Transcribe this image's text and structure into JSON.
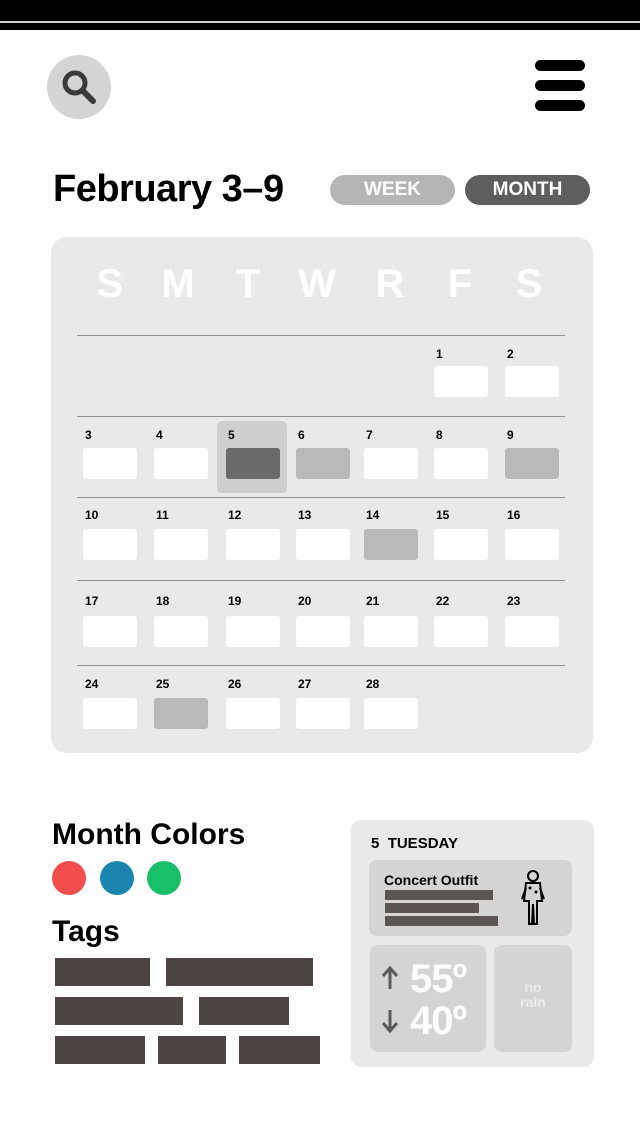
{
  "header": {
    "search_icon": "search-icon",
    "menu_icon": "hamburger-menu-icon"
  },
  "title": "February 3–9",
  "view_toggle": {
    "week_label": "WEEK",
    "month_label": "MONTH"
  },
  "calendar": {
    "weekdays": [
      "S",
      "M",
      "T",
      "W",
      "R",
      "F",
      "S"
    ],
    "days": [
      {
        "day": "1",
        "state": "empty"
      },
      {
        "day": "2",
        "state": "empty"
      },
      {
        "day": "3",
        "state": "empty"
      },
      {
        "day": "4",
        "state": "empty"
      },
      {
        "day": "5",
        "state": "selected"
      },
      {
        "day": "6",
        "state": "event"
      },
      {
        "day": "7",
        "state": "empty"
      },
      {
        "day": "8",
        "state": "empty"
      },
      {
        "day": "9",
        "state": "event"
      },
      {
        "day": "10",
        "state": "empty"
      },
      {
        "day": "11",
        "state": "empty"
      },
      {
        "day": "12",
        "state": "empty"
      },
      {
        "day": "13",
        "state": "empty"
      },
      {
        "day": "14",
        "state": "event"
      },
      {
        "day": "15",
        "state": "empty"
      },
      {
        "day": "16",
        "state": "empty"
      },
      {
        "day": "17",
        "state": "empty"
      },
      {
        "day": "18",
        "state": "empty"
      },
      {
        "day": "19",
        "state": "empty"
      },
      {
        "day": "20",
        "state": "empty"
      },
      {
        "day": "21",
        "state": "empty"
      },
      {
        "day": "22",
        "state": "empty"
      },
      {
        "day": "23",
        "state": "empty"
      },
      {
        "day": "24",
        "state": "empty"
      },
      {
        "day": "25",
        "state": "event"
      },
      {
        "day": "26",
        "state": "empty"
      },
      {
        "day": "27",
        "state": "empty"
      },
      {
        "day": "28",
        "state": "empty"
      }
    ]
  },
  "month_colors": {
    "title": "Month Colors",
    "colors": [
      "#f24e4e",
      "#1a86b0",
      "#17c068"
    ]
  },
  "tags": {
    "title": "Tags"
  },
  "day_detail": {
    "day_number": "5",
    "weekday": "TUESDAY",
    "outfit_title": "Concert Outfit",
    "outfit_icon": "outfit-figure-icon",
    "temp_high": "55º",
    "temp_low": "40º",
    "rain": "no\nrain"
  },
  "colors": {
    "toggle_inactive": "#b5b5b5",
    "toggle_active": "#5e5e5e",
    "panel": "#e9e9e9",
    "event_box": "#b9b9b9",
    "selected_box": "#6a6a6a",
    "tag": "#4d4545"
  }
}
